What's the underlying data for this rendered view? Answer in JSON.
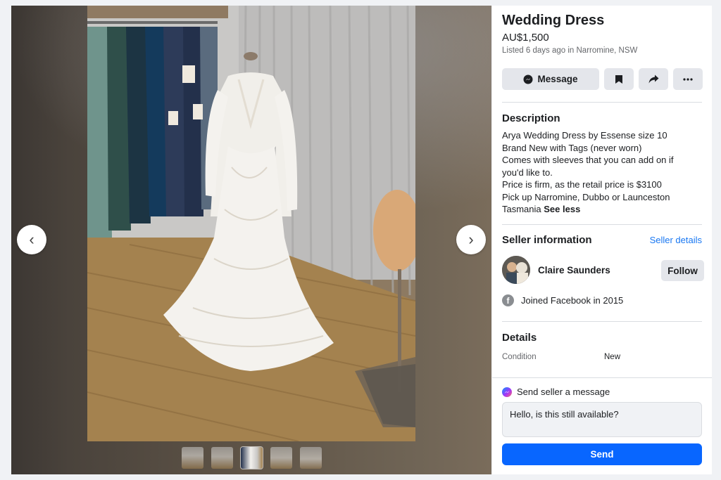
{
  "listing": {
    "title": "Wedding Dress",
    "price": "AU$1,500",
    "listed": "Listed 6 days ago in Narromine, NSW"
  },
  "actions": {
    "message_label": "Message",
    "icons": [
      "messenger-icon",
      "bookmark-icon",
      "share-icon",
      "more-icon"
    ]
  },
  "description": {
    "heading": "Description",
    "lines": [
      "Arya Wedding Dress by Essense size 10",
      "Brand New with Tags (never worn)",
      "Comes with sleeves that you can add on if you'd like to.",
      "Price is firm, as the retail price is $3100",
      "Pick up Narromine, Dubbo or Launceston",
      "Tasmania"
    ],
    "see_less": "See less"
  },
  "seller": {
    "heading": "Seller information",
    "details_link": "Seller details",
    "name": "Claire Saunders",
    "follow_label": "Follow",
    "joined": "Joined Facebook in 2015"
  },
  "details": {
    "heading": "Details",
    "condition_label": "Condition",
    "condition_value": "New"
  },
  "messaging": {
    "send_seller_label": "Send seller a message",
    "input_value": "Hello, is this still available?",
    "send_label": "Send"
  },
  "viewer": {
    "prev_icon": "chevron-left-icon",
    "next_icon": "chevron-right-icon",
    "thumbnail_count": 5,
    "active_thumbnail": 3
  },
  "colors": {
    "accent": "#0866ff",
    "link": "#1877f2",
    "button_gray": "#e4e6eb",
    "muted_text": "#65676b"
  }
}
